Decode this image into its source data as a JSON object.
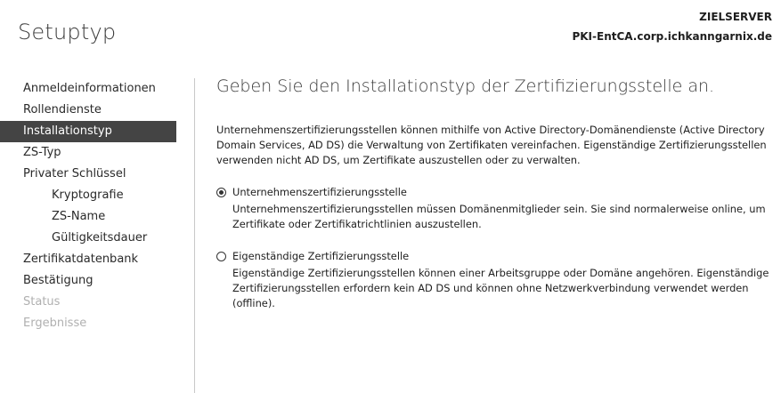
{
  "header": {
    "title": "Setuptyp",
    "target_label": "ZIELSERVER",
    "target_server": "PKI-EntCA.corp.ichkanngarnix.de"
  },
  "sidebar": {
    "items": [
      {
        "label": "Anmeldeinformationen",
        "state": "normal"
      },
      {
        "label": "Rollendienste",
        "state": "normal"
      },
      {
        "label": "Installationstyp",
        "state": "active"
      },
      {
        "label": "ZS-Typ",
        "state": "normal"
      },
      {
        "label": "Privater Schlüssel",
        "state": "normal"
      },
      {
        "label": "Kryptografie",
        "state": "sub"
      },
      {
        "label": "ZS-Name",
        "state": "sub"
      },
      {
        "label": "Gültigkeitsdauer",
        "state": "sub"
      },
      {
        "label": "Zertifikatdatenbank",
        "state": "normal"
      },
      {
        "label": "Bestätigung",
        "state": "normal"
      },
      {
        "label": "Status",
        "state": "disabled"
      },
      {
        "label": "Ergebnisse",
        "state": "disabled"
      }
    ]
  },
  "main": {
    "heading": "Geben Sie den Installationstyp der Zertifizierungsstelle an.",
    "intro": "Unternehmenszertifizierungsstellen können mithilfe von Active Directory-Domänendienste (Active Directory Domain Services, AD DS) die Verwaltung von Zertifikaten vereinfachen. Eigenständige Zertifizierungsstellen verwenden nicht AD DS, um Zertifikate auszustellen oder zu verwalten.",
    "options": [
      {
        "label": "Unternehmenszertifizierungsstelle",
        "selected": true,
        "description": "Unternehmenszertifizierungsstellen müssen Domänenmitglieder sein. Sie sind normalerweise online, um Zertifikate oder Zertifikatrichtlinien auszustellen."
      },
      {
        "label": "Eigenständige Zertifizierungsstelle",
        "selected": false,
        "description": "Eigenständige Zertifizierungsstellen können einer Arbeitsgruppe oder Domäne angehören. Eigenständige Zertifizierungsstellen erfordern kein AD DS und können ohne Netzwerkverbindung verwendet werden (offline)."
      }
    ]
  },
  "colors": {
    "active_nav_bg": "#444444",
    "disabled_text": "#b0b0b0",
    "divider": "#c8c8c8"
  }
}
